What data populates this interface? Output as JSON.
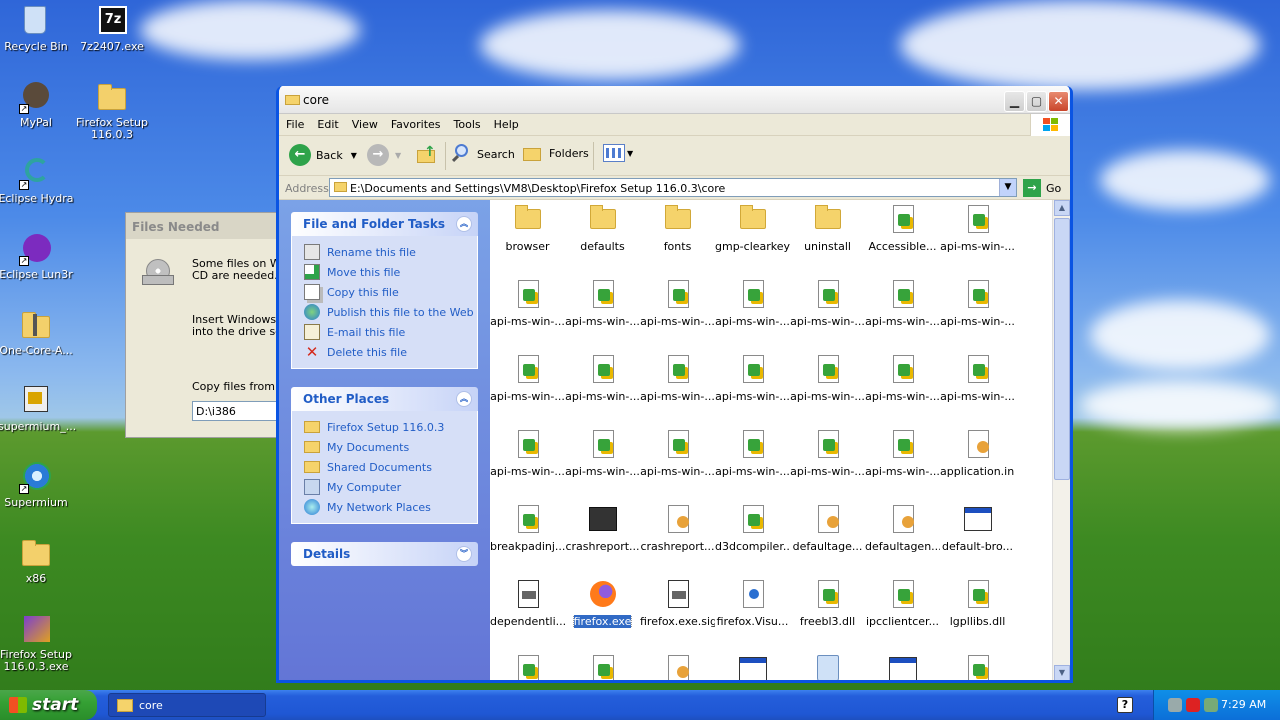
{
  "desktop": {
    "icons": [
      {
        "label": "Recycle Bin"
      },
      {
        "label": "7z2407.exe"
      },
      {
        "label": "MyPal"
      },
      {
        "label": "Firefox Setup 116.0.3"
      },
      {
        "label": "Eclipse Hydra"
      },
      {
        "label": "Eclipse Lun3r"
      },
      {
        "label": "One-Core-A..."
      },
      {
        "label": "supermium_..."
      },
      {
        "label": "Supermium"
      },
      {
        "label": "x86"
      },
      {
        "label": "Firefox Setup 116.0.3.exe"
      }
    ],
    "icon_7z_text": "7z"
  },
  "files_needed": {
    "title": "Files Needed",
    "line1": "Some files on Wir",
    "line2": "CD are needed.",
    "line3": "Insert Windows X",
    "line4": "into the drive sele",
    "copy_label": "Copy files from:",
    "copy_value": "D:\\i386"
  },
  "window": {
    "title": "core",
    "menu": [
      "File",
      "Edit",
      "View",
      "Favorites",
      "Tools",
      "Help"
    ],
    "toolbar": {
      "back": "Back",
      "search": "Search",
      "folders": "Folders"
    },
    "address": {
      "label": "Address",
      "path": "E:\\Documents and Settings\\VM8\\Desktop\\Firefox Setup 116.0.3\\core",
      "go": "Go"
    },
    "tasks": {
      "title": "File and Folder Tasks",
      "items": [
        "Rename this file",
        "Move this file",
        "Copy this file",
        "Publish this file to the Web",
        "E-mail this file",
        "Delete this file"
      ]
    },
    "places": {
      "title": "Other Places",
      "items": [
        "Firefox Setup 116.0.3",
        "My Documents",
        "Shared Documents",
        "My Computer",
        "My Network Places"
      ]
    },
    "details": {
      "title": "Details"
    },
    "files": [
      {
        "name": "browser",
        "icon": "folder"
      },
      {
        "name": "defaults",
        "icon": "folder"
      },
      {
        "name": "fonts",
        "icon": "folder"
      },
      {
        "name": "gmp-clearkey",
        "icon": "folder"
      },
      {
        "name": "uninstall",
        "icon": "folder"
      },
      {
        "name": "Accessible...",
        "icon": "dll"
      },
      {
        "name": "api-ms-win-...",
        "icon": "dll"
      },
      {
        "name": "api-ms-win-...",
        "icon": "dll"
      },
      {
        "name": "api-ms-win-...",
        "icon": "dll"
      },
      {
        "name": "api-ms-win-...",
        "icon": "dll"
      },
      {
        "name": "api-ms-win-...",
        "icon": "dll"
      },
      {
        "name": "api-ms-win-...",
        "icon": "dll"
      },
      {
        "name": "api-ms-win-...",
        "icon": "dll"
      },
      {
        "name": "api-ms-win-...",
        "icon": "dll"
      },
      {
        "name": "api-ms-win-...",
        "icon": "dll"
      },
      {
        "name": "api-ms-win-...",
        "icon": "dll"
      },
      {
        "name": "api-ms-win-...",
        "icon": "dll"
      },
      {
        "name": "api-ms-win-...",
        "icon": "dll"
      },
      {
        "name": "api-ms-win-...",
        "icon": "dll"
      },
      {
        "name": "api-ms-win-...",
        "icon": "dll"
      },
      {
        "name": "api-ms-win-...",
        "icon": "dll"
      },
      {
        "name": "api-ms-win-...",
        "icon": "dll"
      },
      {
        "name": "api-ms-win-...",
        "icon": "dll"
      },
      {
        "name": "api-ms-win-...",
        "icon": "dll"
      },
      {
        "name": "api-ms-win-...",
        "icon": "dll"
      },
      {
        "name": "api-ms-win-...",
        "icon": "dll"
      },
      {
        "name": "api-ms-win-...",
        "icon": "dll"
      },
      {
        "name": "application.ini",
        "icon": "ini"
      },
      {
        "name": "breakpadinj...",
        "icon": "dll"
      },
      {
        "name": "crashreport...",
        "icon": "dark"
      },
      {
        "name": "crashreport...",
        "icon": "ini"
      },
      {
        "name": "d3dcompiler...",
        "icon": "dll"
      },
      {
        "name": "defaultage...",
        "icon": "ini"
      },
      {
        "name": "defaultagen...",
        "icon": "ini"
      },
      {
        "name": "default-bro...",
        "icon": "exe"
      },
      {
        "name": "dependentli...",
        "icon": "sig"
      },
      {
        "name": "firefox.exe",
        "icon": "fox",
        "selected": true
      },
      {
        "name": "firefox.exe.sig",
        "icon": "sig"
      },
      {
        "name": "firefox.Visu...",
        "icon": "xml"
      },
      {
        "name": "freebl3.dll",
        "icon": "dll"
      },
      {
        "name": "ipcclientcer...",
        "icon": "dll"
      },
      {
        "name": "lgpllibs.dll",
        "icon": "dll"
      },
      {
        "name": "",
        "icon": "dll"
      },
      {
        "name": "",
        "icon": "dll"
      },
      {
        "name": "",
        "icon": "ini"
      },
      {
        "name": "",
        "icon": "exe"
      },
      {
        "name": "",
        "icon": "recycle"
      },
      {
        "name": "",
        "icon": "exe"
      },
      {
        "name": "",
        "icon": "dll"
      }
    ]
  },
  "taskbar": {
    "start": "start",
    "task_button": "core",
    "help_glyph": "?",
    "clock": "7:29 AM"
  },
  "colors": {
    "xp_blue": "#0a54e3",
    "link_blue": "#215dc6",
    "selection": "#316ac5"
  }
}
